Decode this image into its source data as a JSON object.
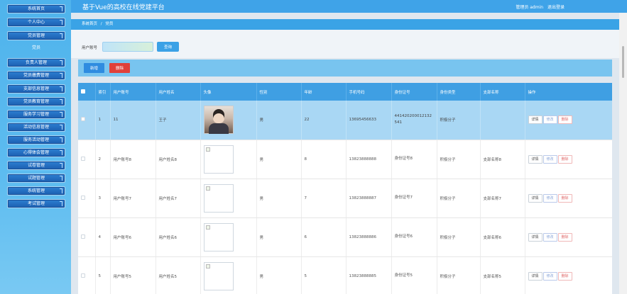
{
  "app_title": "基于Vue的高校在线党建平台",
  "header": {
    "user_label": "管理员 admin",
    "logout_label": "退出登录"
  },
  "sidebar": {
    "items": [
      {
        "label": "系统首页"
      },
      {
        "label": "个人中心"
      },
      {
        "label": "党员管理"
      },
      {
        "label": "负责人管理"
      },
      {
        "label": "党员缴费管理"
      },
      {
        "label": "支部信息管理"
      },
      {
        "label": "党员教育管理"
      },
      {
        "label": "服务学习管理"
      },
      {
        "label": "活动信息管理"
      },
      {
        "label": "服务活动管理"
      },
      {
        "label": "心得体会管理"
      },
      {
        "label": "试卷管理"
      },
      {
        "label": "试题管理"
      },
      {
        "label": "系统管理"
      },
      {
        "label": "考试管理"
      }
    ],
    "sub_label": "党员"
  },
  "breadcrumb": {
    "home": "系统首页",
    "separator": "/",
    "current": "党员"
  },
  "search": {
    "label": "用户账号",
    "value": "",
    "placeholder": "",
    "button_label": "查询"
  },
  "actions": {
    "add_label": "新增",
    "delete_label": "删除"
  },
  "table": {
    "headers": [
      "",
      "索引",
      "用户账号",
      "用户姓名",
      "头像",
      "性别",
      "年龄",
      "手机号码",
      "身份证号",
      "身份类型",
      "支部名称",
      "操作"
    ],
    "op_labels": {
      "detail": "详情",
      "edit": "修改",
      "delete": "删除"
    },
    "rows": [
      {
        "index": "1",
        "account": "11",
        "name": "王子",
        "gender": "男",
        "age": "22",
        "phone": "13695456633",
        "id_no": "441420200012132541",
        "identity": "积极分子",
        "branch": "",
        "photo": true,
        "selected": true
      },
      {
        "index": "2",
        "account": "用户账号8",
        "name": "用户姓名8",
        "gender": "男",
        "age": "8",
        "phone": "13823888888",
        "id_no": "身份证号8",
        "identity": "积极分子",
        "branch": "支部名称8",
        "photo": false,
        "selected": false
      },
      {
        "index": "3",
        "account": "用户账号7",
        "name": "用户姓名7",
        "gender": "男",
        "age": "7",
        "phone": "13823888887",
        "id_no": "身份证号7",
        "identity": "积极分子",
        "branch": "支部名称7",
        "photo": false,
        "selected": false
      },
      {
        "index": "4",
        "account": "用户账号6",
        "name": "用户姓名6",
        "gender": "男",
        "age": "6",
        "phone": "13823888886",
        "id_no": "身份证号6",
        "identity": "积极分子",
        "branch": "支部名称6",
        "photo": false,
        "selected": false
      },
      {
        "index": "5",
        "account": "用户账号5",
        "name": "用户姓名5",
        "gender": "男",
        "age": "5",
        "phone": "13823888885",
        "id_no": "身份证号5",
        "identity": "积极分子",
        "branch": "支部名称5",
        "photo": false,
        "selected": false
      }
    ]
  }
}
